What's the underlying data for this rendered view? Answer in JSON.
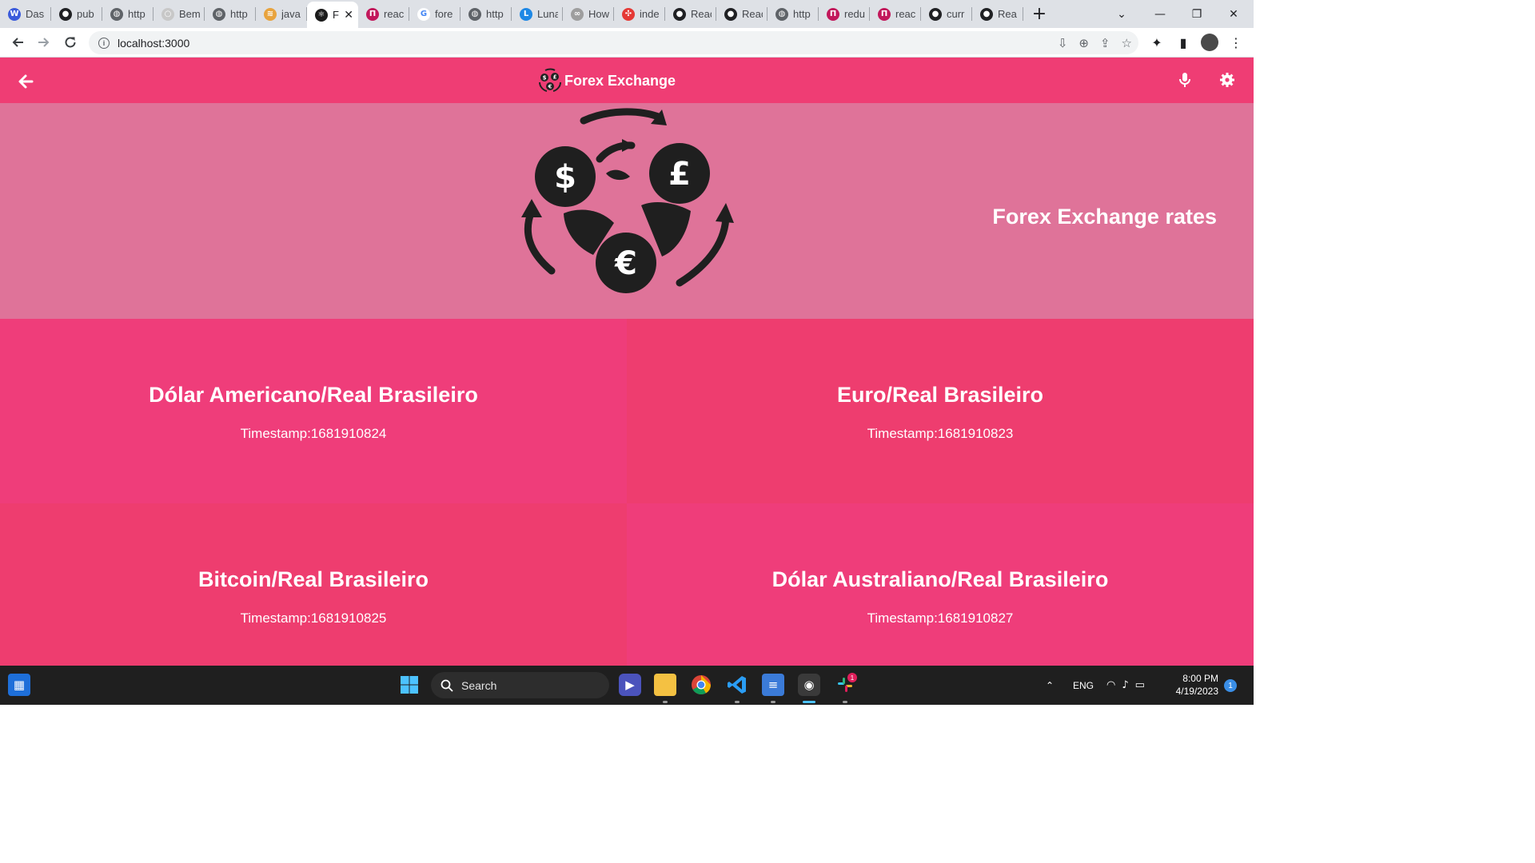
{
  "browser": {
    "tabs": [
      {
        "label": "Das",
        "color": "#3b5bdb",
        "glyph": "W"
      },
      {
        "label": "pub",
        "color": "#202124",
        "glyph": "●"
      },
      {
        "label": "http",
        "color": "#5f6368",
        "glyph": "◍"
      },
      {
        "label": "Bem",
        "color": "#c8c8c8",
        "glyph": "○"
      },
      {
        "label": "http",
        "color": "#5f6368",
        "glyph": "◍"
      },
      {
        "label": "java",
        "color": "#e8a33d",
        "glyph": "≋"
      },
      {
        "label": "F",
        "color": "#1b1b1b",
        "glyph": "⚛",
        "active": true
      },
      {
        "label": "reac",
        "color": "#c2185b",
        "glyph": "Π"
      },
      {
        "label": "fore",
        "color": "#ffffff",
        "glyph": "G"
      },
      {
        "label": "http",
        "color": "#5f6368",
        "glyph": "◍"
      },
      {
        "label": "Luna",
        "color": "#1e88e5",
        "glyph": "L"
      },
      {
        "label": "How",
        "color": "#9e9e9e",
        "glyph": "∞"
      },
      {
        "label": "inde",
        "color": "#e53935",
        "glyph": "✣"
      },
      {
        "label": "Reac",
        "color": "#202124",
        "glyph": "●"
      },
      {
        "label": "Reac",
        "color": "#202124",
        "glyph": "●"
      },
      {
        "label": "http",
        "color": "#5f6368",
        "glyph": "◍"
      },
      {
        "label": "redu",
        "color": "#c2185b",
        "glyph": "Π"
      },
      {
        "label": "reac",
        "color": "#c2185b",
        "glyph": "Π"
      },
      {
        "label": "curr",
        "color": "#202124",
        "glyph": "●"
      },
      {
        "label": "Rea",
        "color": "#202124",
        "glyph": "●"
      }
    ],
    "close_glyph": "✕",
    "newtab_glyph": "+",
    "url": "localhost:3000",
    "window": {
      "minimize": "—",
      "restore": "❐",
      "close": "✕",
      "list": "⌄"
    }
  },
  "app": {
    "brand_title": "Forex Exchange",
    "hero_title": "Forex Exchange rates",
    "colors": {
      "appbar": "#ef3d74",
      "hero": "#df7399",
      "card_a": "#ef3d7a",
      "card_b": "#ee3d6f"
    },
    "icons": {
      "back": "back-arrow-icon",
      "mic": "microphone-icon",
      "settings": "gear-icon",
      "logo": "currency-exchange-logo"
    },
    "pairs": [
      {
        "name": "Dólar Americano/Real Brasileiro",
        "timestamp": "Timestamp:1681910824"
      },
      {
        "name": "Euro/Real Brasileiro",
        "timestamp": "Timestamp:1681910823"
      },
      {
        "name": "Bitcoin/Real Brasileiro",
        "timestamp": "Timestamp:1681910825"
      },
      {
        "name": "Dólar Australiano/Real Brasileiro",
        "timestamp": "Timestamp:1681910827"
      }
    ]
  },
  "taskbar": {
    "search_label": "Search",
    "language": "ENG",
    "time": "8:00 PM",
    "date": "4/19/2023",
    "notification_count": "1",
    "slack_badge": "1"
  }
}
